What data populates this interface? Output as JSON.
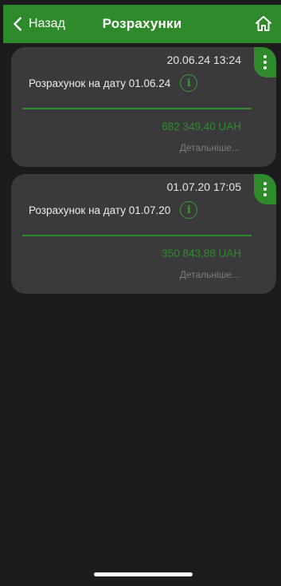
{
  "header": {
    "back_label": "Назад",
    "title": "Розрахунки",
    "back_icon": "chevron-left-icon",
    "home_icon": "home-icon"
  },
  "colors": {
    "accent": "#2f8a2b",
    "background": "#1c1c1e",
    "card": "#3a3a3c"
  },
  "cards": [
    {
      "datetime": "20.06.24 13:24",
      "label": "Розрахунок на дату 01.06.24",
      "amount": "682 349,40 UAH",
      "more": "Детальніше..."
    },
    {
      "datetime": "01.07.20 17:05",
      "label": "Розрахунок на дату 01.07.20",
      "amount": "350 843,88 UAH",
      "more": "Детальніше..."
    }
  ]
}
